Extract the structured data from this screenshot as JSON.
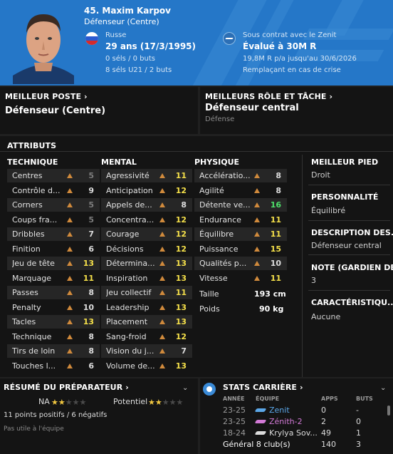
{
  "header": {
    "name": "45. Maxim Karpov",
    "position": "Défenseur (Centre)",
    "nationality": "Russe",
    "age": "29 ans (17/3/1995)",
    "caps": "0 séls / 0 buts",
    "u21_caps": "8 séls U21 / 2 buts",
    "contract": "Sous contrat avec le Zenit",
    "value": "Évalué à 30M R",
    "wage": "19,8M R p/a jusqu'au 30/6/2026",
    "role_status": "Remplaçant en cas de crise"
  },
  "best_position": {
    "title": "MEILLEUR POSTE",
    "value": "Défenseur (Centre)"
  },
  "best_role": {
    "title": "MEILLEURS RÔLE ET TÂCHE",
    "value": "Défenseur central",
    "duty": "Défense"
  },
  "attributes": {
    "title": "ATTRIBUTS",
    "technical": {
      "header": "TECHNIQUE",
      "items": [
        {
          "name": "Centres",
          "value": "5",
          "tier": "low"
        },
        {
          "name": "Contrôle d...",
          "value": "9",
          "tier": "mid"
        },
        {
          "name": "Corners",
          "value": "5",
          "tier": "low"
        },
        {
          "name": "Coups fra...",
          "value": "5",
          "tier": "low"
        },
        {
          "name": "Dribbles",
          "value": "7",
          "tier": "mid"
        },
        {
          "name": "Finition",
          "value": "6",
          "tier": "mid"
        },
        {
          "name": "Jeu de tête",
          "value": "13",
          "tier": "good"
        },
        {
          "name": "Marquage",
          "value": "11",
          "tier": "good"
        },
        {
          "name": "Passes",
          "value": "8",
          "tier": "mid"
        },
        {
          "name": "Penalty",
          "value": "10",
          "tier": "mid"
        },
        {
          "name": "Tacles",
          "value": "13",
          "tier": "good"
        },
        {
          "name": "Technique",
          "value": "8",
          "tier": "mid"
        },
        {
          "name": "Tirs de loin",
          "value": "8",
          "tier": "mid"
        },
        {
          "name": "Touches l...",
          "value": "6",
          "tier": "mid"
        }
      ]
    },
    "mental": {
      "header": "MENTAL",
      "items": [
        {
          "name": "Agressivité",
          "value": "11",
          "tier": "good"
        },
        {
          "name": "Anticipation",
          "value": "12",
          "tier": "good"
        },
        {
          "name": "Appels de...",
          "value": "8",
          "tier": "mid"
        },
        {
          "name": "Concentra...",
          "value": "12",
          "tier": "good"
        },
        {
          "name": "Courage",
          "value": "12",
          "tier": "good"
        },
        {
          "name": "Décisions",
          "value": "12",
          "tier": "good"
        },
        {
          "name": "Détermina...",
          "value": "13",
          "tier": "good"
        },
        {
          "name": "Inspiration",
          "value": "13",
          "tier": "good"
        },
        {
          "name": "Jeu collectif",
          "value": "11",
          "tier": "good"
        },
        {
          "name": "Leadership",
          "value": "13",
          "tier": "good"
        },
        {
          "name": "Placement",
          "value": "13",
          "tier": "good"
        },
        {
          "name": "Sang-froid",
          "value": "12",
          "tier": "good"
        },
        {
          "name": "Vision du j...",
          "value": "7",
          "tier": "mid"
        },
        {
          "name": "Volume de...",
          "value": "13",
          "tier": "good"
        }
      ]
    },
    "physical": {
      "header": "PHYSIQUE",
      "items": [
        {
          "name": "Accélératio...",
          "value": "8",
          "tier": "mid"
        },
        {
          "name": "Agilité",
          "value": "8",
          "tier": "mid"
        },
        {
          "name": "Détente ve...",
          "value": "16",
          "tier": "top"
        },
        {
          "name": "Endurance",
          "value": "11",
          "tier": "good"
        },
        {
          "name": "Équilibre",
          "value": "11",
          "tier": "good"
        },
        {
          "name": "Puissance",
          "value": "15",
          "tier": "good"
        },
        {
          "name": "Qualités p...",
          "value": "10",
          "tier": "mid"
        },
        {
          "name": "Vitesse",
          "value": "11",
          "tier": "good"
        }
      ],
      "height_label": "Taille",
      "height": "193 cm",
      "weight_label": "Poids",
      "weight": "90 kg"
    }
  },
  "side": {
    "foot_title": "MEILLEUR PIED",
    "foot": "Droit",
    "personality_title": "PERSONNALITÉ",
    "personality": "Équilibré",
    "desc_title": "DESCRIPTION DES...",
    "desc": "Défenseur central",
    "gk_title": "NOTE (GARDIEN DE...",
    "gk": "3",
    "traits_title": "CARACTÉRISTIQU...",
    "traits": "Aucune"
  },
  "coach": {
    "title": "RÉSUMÉ DU PRÉPARATEUR",
    "current_label": "NA",
    "current_stars": 2,
    "potential_label": "Potentiel",
    "potential_stars": 2,
    "summary": "11 points positifs / 6 négatifs",
    "note": "Pas utile à l'équipe"
  },
  "career": {
    "title": "STATS CARRIÈRE",
    "headers": {
      "year": "ANNÉE",
      "team": "ÉQUIPE",
      "apps": "APPS",
      "goals": "BUTS"
    },
    "rows": [
      {
        "year": "23-25",
        "team": "Zenit",
        "apps": "0",
        "goals": "-",
        "color": "#5ba7e8"
      },
      {
        "year": "23-25",
        "team": "Zénith-2",
        "apps": "2",
        "goals": "0",
        "color": "#d27ad6"
      },
      {
        "year": "18-24",
        "team": "Krylya Sov...",
        "apps": "49",
        "goals": "1",
        "color": "#dcdcdc"
      }
    ],
    "total_label": "Général 8 club(s)",
    "total_apps": "140",
    "total_goals": "3"
  },
  "colors": {
    "header_bg": "#2577c8",
    "panel_bg": "#141414",
    "arrow": "#d08a3c",
    "good": "#f5e04a",
    "top": "#4ee06a"
  }
}
